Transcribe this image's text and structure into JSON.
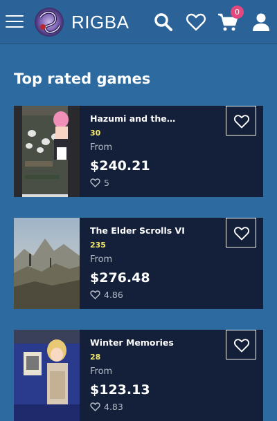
{
  "header": {
    "brand": "RIGBA",
    "cart_count": "0",
    "icons": [
      "menu-icon",
      "logo",
      "search-icon",
      "heart-icon",
      "cart-icon",
      "user-icon"
    ]
  },
  "section": {
    "title": "Top rated games"
  },
  "games": [
    {
      "title": "Hazumi and the…",
      "count": "30",
      "from_label": "From",
      "price": "$240.21",
      "rating": "5"
    },
    {
      "title": "The Elder Scrolls VI",
      "count": "235",
      "from_label": "From",
      "price": "$276.48",
      "rating": "4.86"
    },
    {
      "title": "Winter Memories",
      "count": "28",
      "from_label": "From",
      "price": "$123.13",
      "rating": "4.83"
    }
  ],
  "colors": {
    "background": "#2d6aa0",
    "header": "#2b6297",
    "card": "#14203a",
    "count_yellow": "#f3ea6a",
    "badge_pink": "#e2487e",
    "muted_text": "#b5bcc6"
  }
}
